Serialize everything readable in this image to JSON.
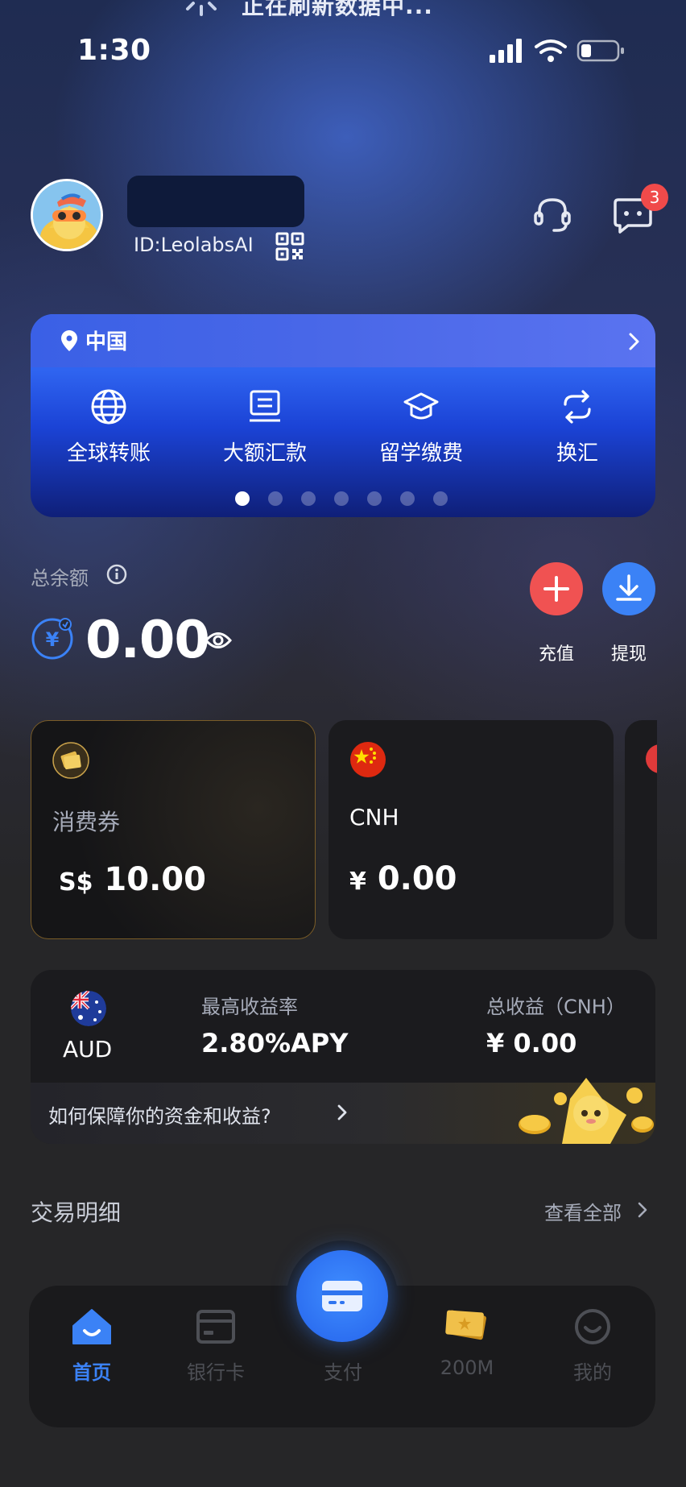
{
  "status_bar": {
    "time": "1:30",
    "refresh_text": "正在刷新数据中...",
    "icons": [
      "signal-icon",
      "wifi-icon",
      "battery-icon"
    ]
  },
  "profile": {
    "user_id": "ID:LeolabsAI",
    "message_badge": "3",
    "icons": [
      "avatar",
      "qr-code-icon",
      "customer-service-icon",
      "message-icon"
    ]
  },
  "region_card": {
    "region": "中国",
    "services": [
      {
        "label": "全球转账",
        "icon": "globe-icon"
      },
      {
        "label": "大额汇款",
        "icon": "remittance-icon"
      },
      {
        "label": "留学缴费",
        "icon": "graduation-cap-icon"
      },
      {
        "label": "换汇",
        "icon": "exchange-icon"
      }
    ],
    "page_count": 7,
    "active_page": 0
  },
  "balance": {
    "label": "总余额",
    "value": "0.00",
    "recharge_label": "充值",
    "withdraw_label": "提现"
  },
  "currency_cards": [
    {
      "name": "消费券",
      "symbol": "S$",
      "amount": "10.00",
      "icon": "voucher-coin-icon"
    },
    {
      "name": "CNH",
      "symbol": "¥",
      "amount": "0.00",
      "icon": "china-flag-icon"
    }
  ],
  "savings": {
    "currency": "AUD",
    "rate_label": "最高收益率",
    "rate_value": "2.80%APY",
    "earn_label": "总收益（CNH）",
    "earn_value": "¥ 0.00",
    "link_text": "如何保障你的资金和收益?"
  },
  "transactions": {
    "title": "交易明细",
    "view_all": "查看全部"
  },
  "bottom_nav": {
    "items": [
      {
        "label": "首页",
        "icon": "home-icon",
        "active": true
      },
      {
        "label": "银行卡",
        "icon": "bank-card-icon",
        "active": false
      },
      {
        "label": "支付",
        "icon": "pay-card-icon",
        "active": false
      },
      {
        "label": "200M",
        "icon": "ticket-icon",
        "active": false
      },
      {
        "label": "我的",
        "icon": "smiley-icon",
        "active": false
      }
    ]
  },
  "colors": {
    "accent_blue": "#3b82f6",
    "recharge_red": "#f05252",
    "badge_red": "#f04a4a",
    "background": "#262628"
  }
}
